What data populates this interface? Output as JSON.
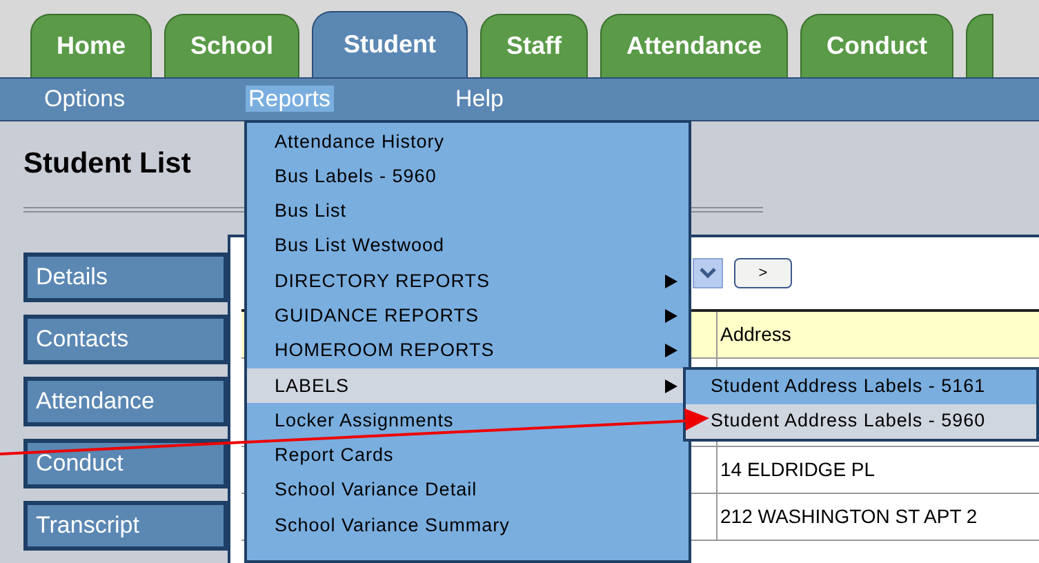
{
  "tabs": [
    {
      "label": "Home",
      "selected": false
    },
    {
      "label": "School",
      "selected": false
    },
    {
      "label": "Student",
      "selected": true
    },
    {
      "label": "Staff",
      "selected": false
    },
    {
      "label": "Attendance",
      "selected": false
    },
    {
      "label": "Conduct",
      "selected": false
    }
  ],
  "menu_bar": [
    {
      "label": "Options",
      "selected": false
    },
    {
      "label": "Reports",
      "selected": true
    },
    {
      "label": "Help",
      "selected": false
    }
  ],
  "page_title": "Student List",
  "side_buttons": [
    "Details",
    "Contacts",
    "Attendance",
    "Conduct",
    "Transcript"
  ],
  "next_button": ">",
  "table": {
    "columns": [
      "Address"
    ],
    "rows": [
      "14 ELDRIDGE PL",
      "212 WASHINGTON ST APT 2"
    ]
  },
  "reports_menu": [
    {
      "label": "Attendance History",
      "submenu": false,
      "selected": false
    },
    {
      "label": "Bus Labels - 5960",
      "submenu": false,
      "selected": false
    },
    {
      "label": "Bus List",
      "submenu": false,
      "selected": false
    },
    {
      "label": "Bus List Westwood",
      "submenu": false,
      "selected": false
    },
    {
      "label": "DIRECTORY REPORTS",
      "submenu": true,
      "selected": false
    },
    {
      "label": "GUIDANCE REPORTS",
      "submenu": true,
      "selected": false
    },
    {
      "label": "HOMEROOM REPORTS",
      "submenu": true,
      "selected": false
    },
    {
      "label": "LABELS",
      "submenu": true,
      "selected": true
    },
    {
      "label": "Locker Assignments",
      "submenu": false,
      "selected": false
    },
    {
      "label": "Report Cards",
      "submenu": false,
      "selected": false
    },
    {
      "label": "School Variance Detail",
      "submenu": false,
      "selected": false
    },
    {
      "label": "School Variance Summary",
      "submenu": false,
      "selected": false
    }
  ],
  "labels_submenu": [
    {
      "label": "Student Address Labels - 5161",
      "selected": false
    },
    {
      "label": "Student Address Labels - 5960",
      "selected": true
    }
  ]
}
